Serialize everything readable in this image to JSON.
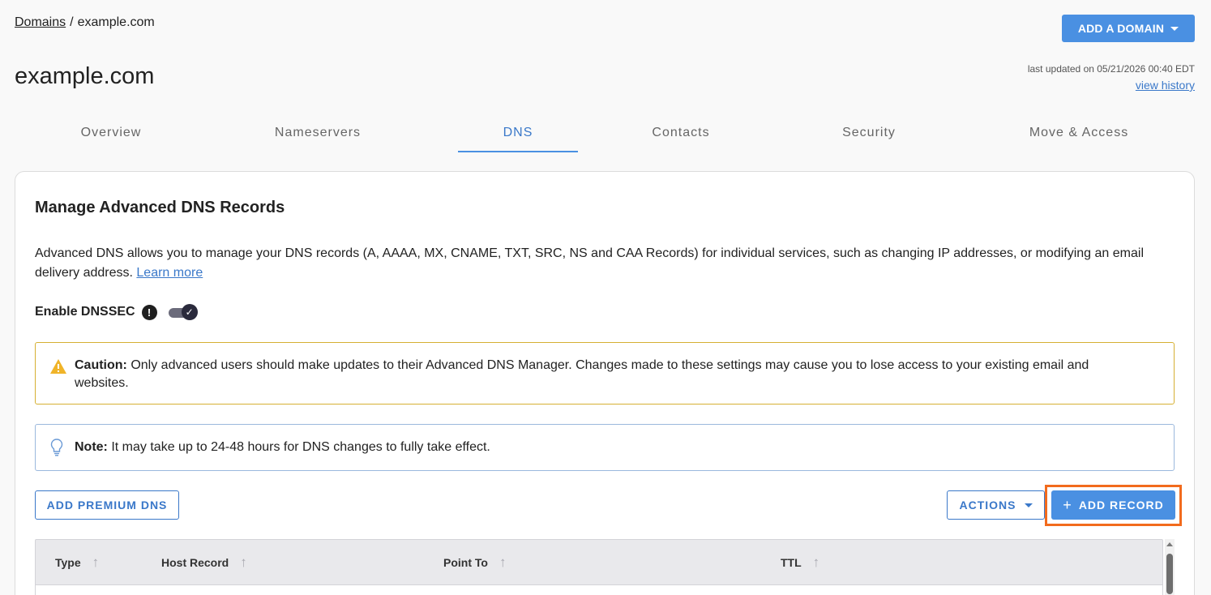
{
  "breadcrumb": {
    "root": "Domains",
    "separator": "/",
    "current": "example.com"
  },
  "header": {
    "add_domain_label": "ADD A DOMAIN",
    "title": "example.com",
    "last_updated": "last updated on 05/21/2026 00:40 EDT",
    "view_history": "view history"
  },
  "tabs": [
    {
      "label": "Overview",
      "active": false
    },
    {
      "label": "Nameservers",
      "active": false
    },
    {
      "label": "DNS",
      "active": true
    },
    {
      "label": "Contacts",
      "active": false
    },
    {
      "label": "Security",
      "active": false
    },
    {
      "label": "Move & Access",
      "active": false
    }
  ],
  "card": {
    "title": "Manage Advanced DNS Records",
    "description": "Advanced DNS allows you to manage your DNS records (A, AAAA, MX, CNAME, TXT, SRC, NS and CAA Records) for individual services, such as changing IP addresses, or modifying an email delivery address.",
    "learn_more": "Learn more",
    "dnssec_label": "Enable DNSSEC",
    "dnssec_info_glyph": "!",
    "dnssec_enabled": true
  },
  "caution": {
    "label": "Caution:",
    "text": "Only advanced users should make updates to their Advanced DNS Manager. Changes made to these settings may cause you to lose access to your existing email and websites."
  },
  "note": {
    "label": "Note:",
    "text": "It may take up to 24-48 hours for DNS changes to fully take effect."
  },
  "buttons": {
    "add_premium_dns": "ADD PREMIUM DNS",
    "actions": "ACTIONS",
    "add_record": "ADD RECORD"
  },
  "table": {
    "columns": [
      "Type",
      "Host Record",
      "Point To",
      "TTL"
    ]
  },
  "colors": {
    "accent": "#4a90e2",
    "link": "#3a78c9",
    "caution_border": "#d6b033",
    "note_border": "#9bb8dd",
    "highlight": "#f26b1d"
  }
}
